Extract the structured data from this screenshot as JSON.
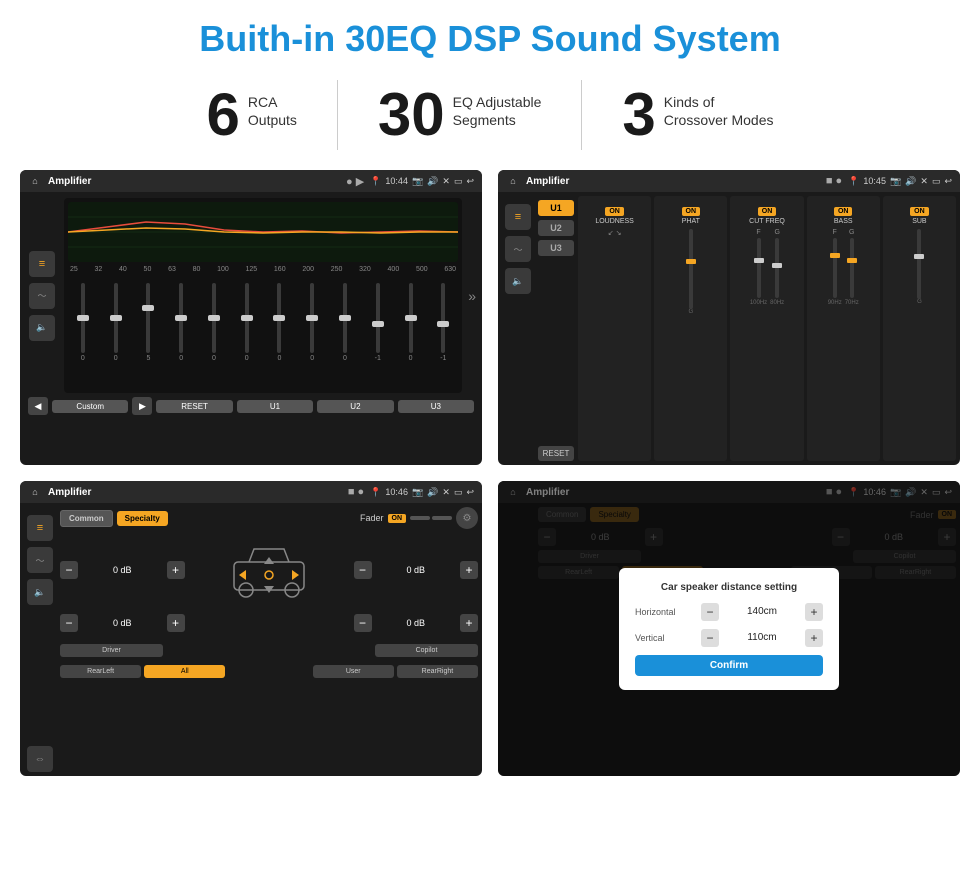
{
  "page": {
    "title": "Buith-in 30EQ DSP Sound System"
  },
  "stats": [
    {
      "number": "6",
      "line1": "RCA",
      "line2": "Outputs"
    },
    {
      "number": "30",
      "line1": "EQ Adjustable",
      "line2": "Segments"
    },
    {
      "number": "3",
      "line1": "Kinds of",
      "line2": "Crossover Modes"
    }
  ],
  "screens": {
    "eq": {
      "title": "Amplifier",
      "time": "10:44",
      "freq_labels": [
        "25",
        "32",
        "40",
        "50",
        "63",
        "80",
        "100",
        "125",
        "160",
        "200",
        "250",
        "320",
        "400",
        "500",
        "630"
      ],
      "slider_values": [
        "0",
        "0",
        "0",
        "5",
        "0",
        "0",
        "0",
        "0",
        "0",
        "0",
        "0",
        "-1",
        "0",
        "-1"
      ],
      "bottom_btns": [
        "Custom",
        "RESET",
        "U1",
        "U2",
        "U3"
      ]
    },
    "crossover": {
      "title": "Amplifier",
      "time": "10:45",
      "u_buttons": [
        "U1",
        "U2",
        "U3"
      ],
      "controls": [
        "LOUDNESS",
        "PHAT",
        "CUT FREQ",
        "BASS",
        "SUB"
      ]
    },
    "fader": {
      "title": "Amplifier",
      "time": "10:46",
      "modes": [
        "Common",
        "Specialty"
      ],
      "fader_label": "Fader",
      "vol_values": [
        "0 dB",
        "0 dB",
        "0 dB",
        "0 dB"
      ],
      "bottom_btns": [
        "Driver",
        "",
        "",
        "",
        "Copilot"
      ],
      "bottom_row2": [
        "RearLeft",
        "All",
        "",
        "User",
        "RearRight"
      ]
    },
    "dialog": {
      "title": "Amplifier",
      "time": "10:46",
      "dialog_title": "Car speaker distance setting",
      "horizontal_label": "Horizontal",
      "horizontal_value": "140cm",
      "vertical_label": "Vertical",
      "vertical_value": "110cm",
      "confirm_label": "Confirm"
    }
  }
}
